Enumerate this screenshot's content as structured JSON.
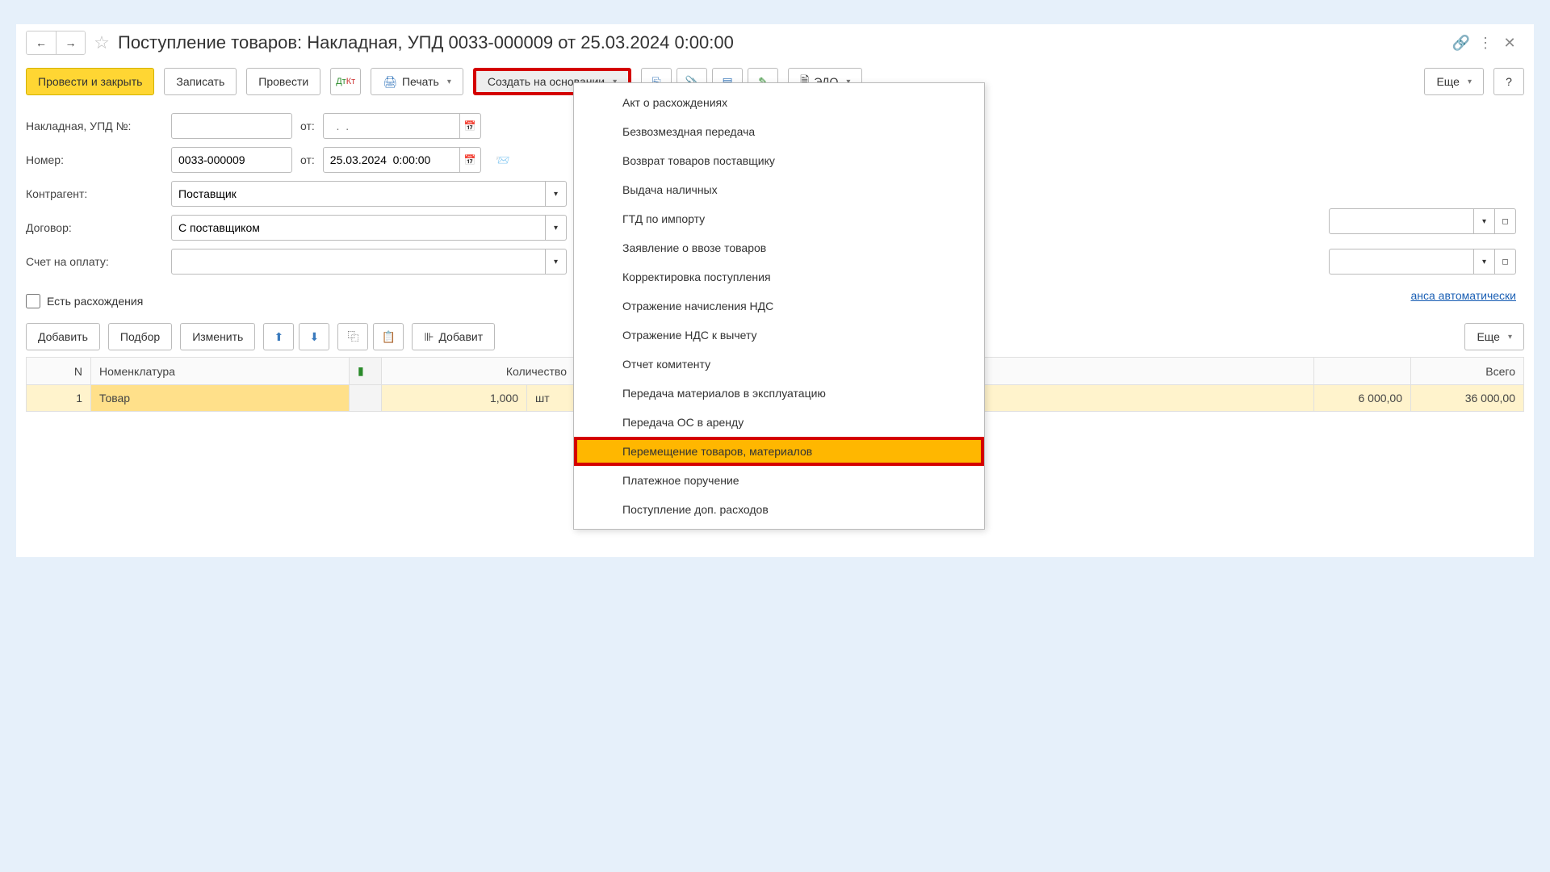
{
  "title": "Поступление товаров: Накладная, УПД 0033-000009 от 25.03.2024 0:00:00",
  "toolbar": {
    "post_close": "Провести и закрыть",
    "write": "Записать",
    "post": "Провести",
    "print": "Печать",
    "create_based": "Создать на основании",
    "edo": "ЭДО",
    "more": "Еще",
    "help": "?"
  },
  "form": {
    "invoice_label": "Накладная, УПД №:",
    "invoice_value": "",
    "from_label": "от:",
    "from_value": "",
    "number_label": "Номер:",
    "number_value": "0033-000009",
    "date_value": "25.03.2024  0:00:00",
    "contractor_label": "Контрагент:",
    "contractor_value": "Поставщик",
    "contract_label": "Договор:",
    "contract_value": "С поставщиком",
    "bill_label": "Счет на оплату:",
    "bill_value": "",
    "has_diff": "Есть расхождения",
    "auto_link": "анса автоматически"
  },
  "table_toolbar": {
    "add": "Добавить",
    "pick": "Подбор",
    "change": "Изменить",
    "add_by": "Добавит",
    "more": "Еще"
  },
  "table": {
    "headers": {
      "n": "N",
      "nom": "Номенклатура",
      "qty": "Количество",
      "total": "Всего"
    },
    "rows": [
      {
        "n": "1",
        "nom": "Товар",
        "qty": "1,000",
        "unit": "шт",
        "price": "6 000,00",
        "total": "36 000,00"
      }
    ]
  },
  "menu": {
    "items": [
      "Акт о расхождениях",
      "Безвозмездная передача",
      "Возврат товаров поставщику",
      "Выдача наличных",
      "ГТД по импорту",
      "Заявление о ввозе товаров",
      "Корректировка поступления",
      "Отражение начисления НДС",
      "Отражение НДС к вычету",
      "Отчет комитенту",
      "Передача материалов в эксплуатацию",
      "Передача ОС в аренду",
      "Перемещение товаров, материалов",
      "Платежное поручение",
      "Поступление доп. расходов"
    ],
    "highlighted_index": 12
  }
}
